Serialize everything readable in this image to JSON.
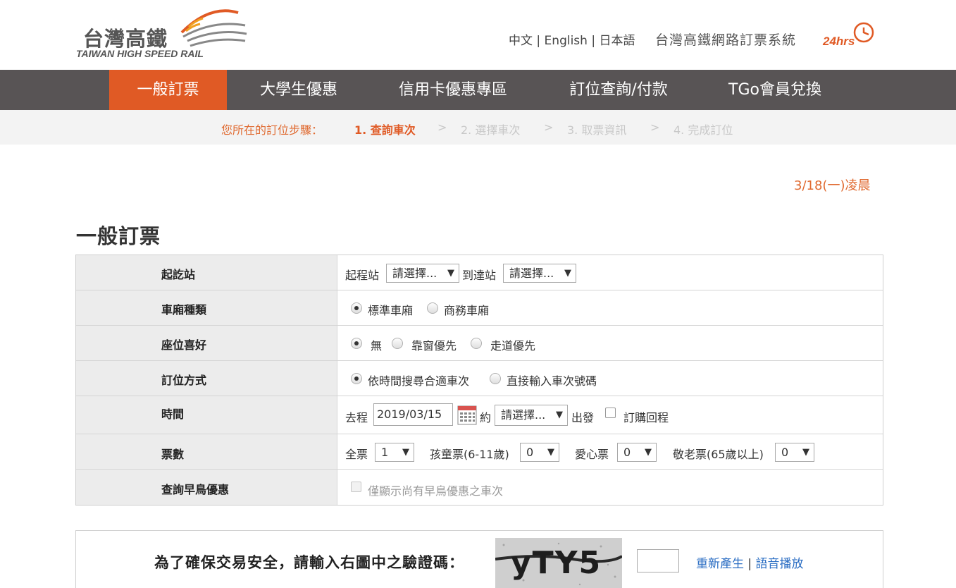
{
  "brand": {
    "name_cn": "台灣高鐵",
    "name_en": "TAIWAN HIGH SPEED RAIL",
    "system_title": "台灣高鐵網路訂票系統",
    "hrs_badge": "24hrs",
    "accent_color": "#e05a25"
  },
  "languages": {
    "zh": "中文",
    "sep1": " | ",
    "en": "English",
    "sep2": " | ",
    "ja": "日本語"
  },
  "nav": {
    "items": [
      {
        "label": "一般訂票",
        "active": true
      },
      {
        "label": "大學生優惠",
        "active": false
      },
      {
        "label": "信用卡優惠專區",
        "active": false
      },
      {
        "label": "訂位查詢/付款",
        "active": false
      },
      {
        "label": "TGo會員兌換",
        "active": false
      }
    ]
  },
  "steps": {
    "lead": "您所在的訂位步驟：",
    "items": [
      "1. 查詢車次",
      "2. 選擇車次",
      "3. 取票資訊",
      "4. 完成訂位"
    ],
    "separator": ">",
    "current_index": 0
  },
  "date_note": "3/18(一)凌晨",
  "page_title": "一般訂票",
  "form": {
    "stations": {
      "label": "起訖站",
      "from_label": "起程站",
      "from_value": "請選擇...",
      "to_label": "到達站",
      "to_value": "請選擇..."
    },
    "car_type": {
      "label": "車廂種類",
      "options": [
        "標準車廂",
        "商務車廂"
      ],
      "selected": 0
    },
    "seat_pref": {
      "label": "座位喜好",
      "options": [
        "無",
        "靠窗優先",
        "走道優先"
      ],
      "selected": 0
    },
    "booking_method": {
      "label": "訂位方式",
      "options": [
        "依時間搜尋合適車次",
        "直接輸入車次號碼"
      ],
      "selected": 0
    },
    "time": {
      "label": "時間",
      "outbound_label": "去程",
      "date_value": "2019/03/15",
      "approx_label": "約",
      "time_value": "請選擇...",
      "depart_label": "出發",
      "return_label": "訂購回程",
      "return_checked": false
    },
    "tickets": {
      "label": "票數",
      "adult_label": "全票",
      "adult_value": "1",
      "child_label": "孩童票(6-11歲)",
      "child_value": "0",
      "disabled_label": "愛心票",
      "disabled_value": "0",
      "senior_label": "敬老票(65歲以上)",
      "senior_value": "0"
    },
    "early_bird": {
      "label": "查詢早鳥優惠",
      "option_label": "僅顯示尚有早鳥優惠之車次",
      "checked": false,
      "disabled": true
    }
  },
  "captcha": {
    "label": "為了確保交易安全，請輸入右圖中之驗證碼：",
    "image_text": "yTY5",
    "input_value": "",
    "regen_label": "重新產生",
    "sep": " | ",
    "audio_label": "語音播放"
  }
}
